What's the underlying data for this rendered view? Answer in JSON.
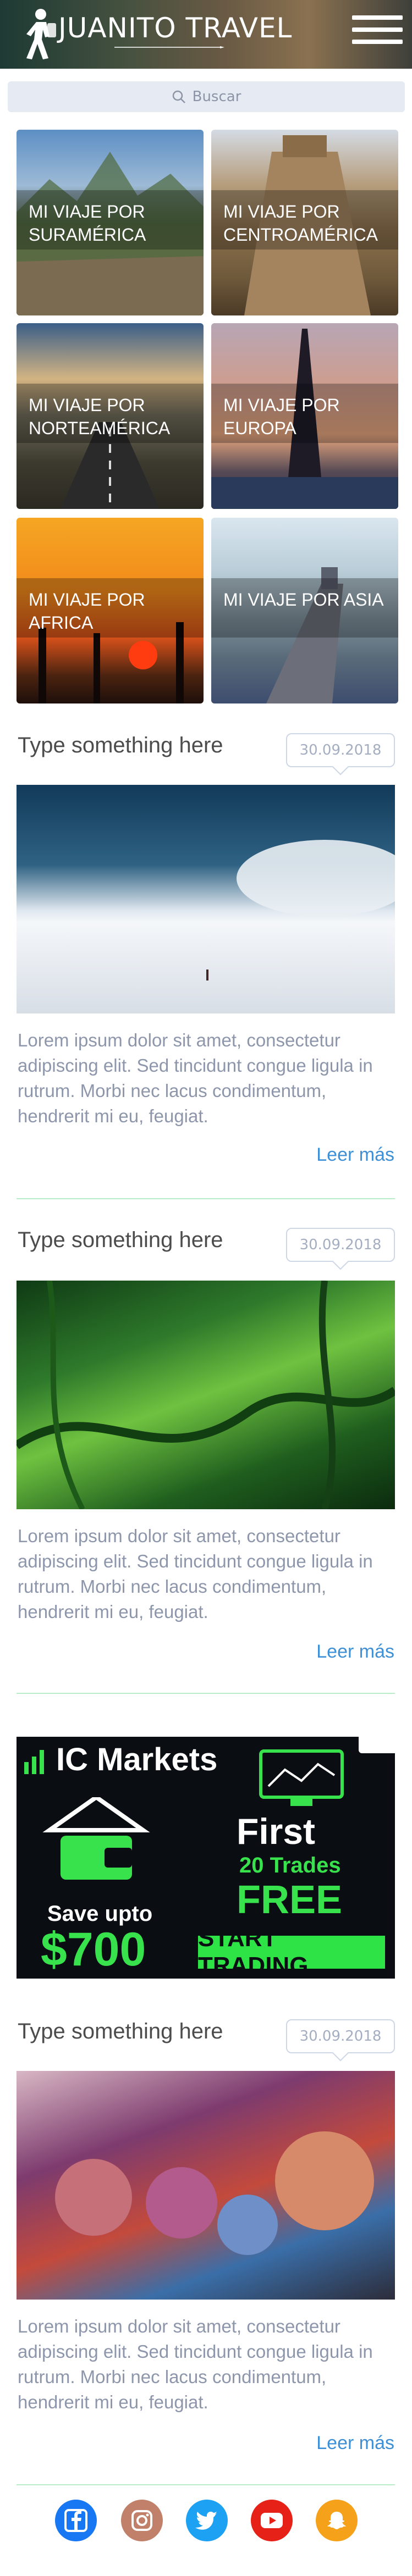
{
  "header": {
    "brand": "JUANITO TRAVEL",
    "colors": {
      "text": "#ffffff"
    }
  },
  "search": {
    "placeholder": "Buscar"
  },
  "destinations": [
    {
      "label": "MI VIAJE POR SURAMÉRICA"
    },
    {
      "label": "MI VIAJE POR CENTROAMÉRICA"
    },
    {
      "label": "MI VIAJE POR NORTEAMÉRICA"
    },
    {
      "label": "MI VIAJE POR EUROPA"
    },
    {
      "label": "MI VIAJE POR AFRICA"
    },
    {
      "label": "MI VIAJE POR ASIA"
    }
  ],
  "posts": [
    {
      "title": "Type something here",
      "date": "30.09.2018",
      "text": "Lorem ipsum dolor sit amet, consectetur adipiscing elit. Sed tincidunt congue ligula in rutrum. Morbi nec lacus condimentum, hendrerit mi eu, feugiat.",
      "more": "Leer más"
    },
    {
      "title": "Type something here",
      "date": "30.09.2018",
      "text": "Lorem ipsum dolor sit amet, consectetur adipiscing elit. Sed tincidunt congue ligula in rutrum. Morbi nec lacus condimentum, hendrerit mi eu, feugiat.",
      "more": "Leer más"
    },
    {
      "title": "Type something here",
      "date": "30.09.2018",
      "text": "Lorem ipsum dolor sit amet, consectetur adipiscing elit. Sed tincidunt congue ligula in rutrum. Morbi nec lacus condimentum, hendrerit mi eu, feugiat.",
      "more": "Leer más"
    }
  ],
  "ad": {
    "brand": "IC Markets",
    "line1": "First",
    "line2": "20 Trades",
    "line3": "FREE",
    "save": "Save upto",
    "amount": "$700",
    "cta": "START TRADING"
  },
  "social": [
    {
      "icon": "facebook-icon",
      "color": "#1877f2"
    },
    {
      "icon": "instagram-icon",
      "color": "#c0806a"
    },
    {
      "icon": "twitter-icon",
      "color": "#1da1f2"
    },
    {
      "icon": "youtube-icon",
      "color": "#e62117"
    },
    {
      "icon": "snapchat-icon",
      "color": "#f6a11a"
    }
  ],
  "colors": {
    "link": "#3d8fd6",
    "divider": "#b7eec8",
    "body_text": "#8d96aa"
  }
}
